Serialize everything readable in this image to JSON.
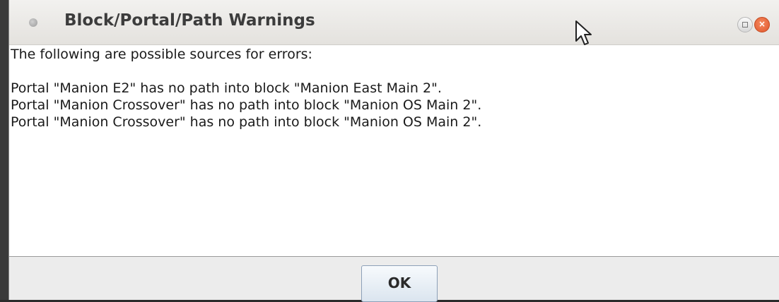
{
  "window": {
    "title": "Block/Portal/Path Warnings"
  },
  "message": {
    "intro": "The following are possible sources for errors:",
    "warnings": [
      "Portal \"Manion E2\" has no path into block \"Manion East Main 2\".",
      "Portal \"Manion Crossover\" has no path into block \"Manion OS Main 2\".",
      "Portal \"Manion Crossover\" has no path into block \"Manion OS Main 2\"."
    ]
  },
  "buttons": {
    "ok_label": "OK",
    "close_symbol": "×"
  },
  "icons": {
    "window_menu": "window-menu-dot-icon",
    "maximize": "maximize-icon",
    "close": "close-icon",
    "cursor": "mouse-pointer-icon"
  },
  "colors": {
    "close_button": "#e0552b",
    "ok_button_border": "#8ca0b8"
  }
}
